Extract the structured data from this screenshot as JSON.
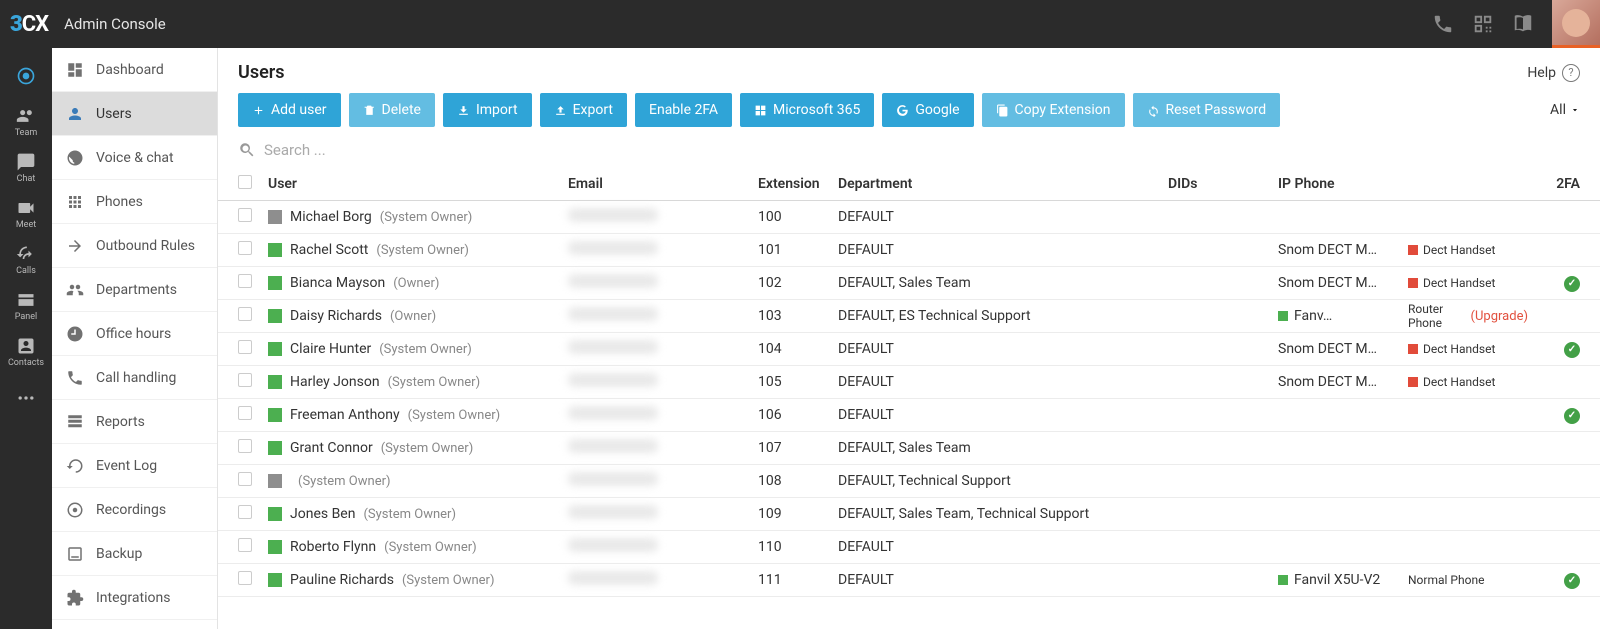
{
  "brand": {
    "name": "3CX",
    "subtitle": "Admin Console"
  },
  "help_label": "Help",
  "iconbar": [
    {
      "name": "chrome",
      "label": ""
    },
    {
      "name": "team",
      "label": "Team"
    },
    {
      "name": "chat",
      "label": "Chat"
    },
    {
      "name": "meet",
      "label": "Meet"
    },
    {
      "name": "calls",
      "label": "Calls"
    },
    {
      "name": "panel",
      "label": "Panel"
    },
    {
      "name": "contacts",
      "label": "Contacts"
    },
    {
      "name": "more",
      "label": ""
    }
  ],
  "sidenav": [
    {
      "name": "dashboard",
      "label": "Dashboard"
    },
    {
      "name": "users",
      "label": "Users",
      "active": true
    },
    {
      "name": "voice-chat",
      "label": "Voice & chat"
    },
    {
      "name": "phones",
      "label": "Phones"
    },
    {
      "name": "outbound-rules",
      "label": "Outbound Rules"
    },
    {
      "name": "departments",
      "label": "Departments"
    },
    {
      "name": "office-hours",
      "label": "Office hours"
    },
    {
      "name": "call-handling",
      "label": "Call handling"
    },
    {
      "name": "reports",
      "label": "Reports"
    },
    {
      "name": "event-log",
      "label": "Event Log"
    },
    {
      "name": "recordings",
      "label": "Recordings"
    },
    {
      "name": "backup",
      "label": "Backup"
    },
    {
      "name": "integrations",
      "label": "Integrations"
    }
  ],
  "page_title": "Users",
  "toolbar": {
    "add_user": "Add user",
    "delete": "Delete",
    "import": "Import",
    "export": "Export",
    "enable_2fa": "Enable 2FA",
    "microsoft_365": "Microsoft 365",
    "google": "Google",
    "copy_extension": "Copy Extension",
    "reset_password": "Reset Password",
    "filter": "All"
  },
  "search_placeholder": "Search ...",
  "columns": {
    "user": "User",
    "email": "Email",
    "extension": "Extension",
    "department": "Department",
    "dids": "DIDs",
    "ip_phone": "IP Phone",
    "twofa": "2FA"
  },
  "rows": [
    {
      "status": "grey",
      "name": "Michael Borg",
      "role": "(System Owner)",
      "ext": "100",
      "dept": "DEFAULT",
      "ip": "",
      "tag": "",
      "tag_status": "",
      "twofa": false
    },
    {
      "status": "green",
      "name": "Rachel Scott",
      "role": "(System Owner)",
      "ext": "101",
      "dept": "DEFAULT",
      "ip": "Snom DECT M…",
      "tag": "Dect Handset",
      "tag_status": "red",
      "twofa": false
    },
    {
      "status": "green",
      "name": "Bianca Mayson",
      "role": "(Owner)",
      "ext": "102",
      "dept": "DEFAULT, Sales Team",
      "ip": "Snom DECT M…",
      "tag": "Dect Handset",
      "tag_status": "red",
      "twofa": true
    },
    {
      "status": "green",
      "name": "Daisy Richards",
      "role": "(Owner)",
      "ext": "103",
      "dept": "DEFAULT, ES Technical Support",
      "ip": "Fanv…",
      "ip_status": "green",
      "tag": "Router Phone",
      "tag_extra": "(Upgrade)",
      "tag_status": "",
      "twofa": false
    },
    {
      "status": "green",
      "name": "Claire Hunter",
      "role": "(System Owner)",
      "ext": "104",
      "dept": "DEFAULT",
      "ip": "Snom DECT M…",
      "tag": "Dect Handset",
      "tag_status": "red",
      "twofa": true
    },
    {
      "status": "green",
      "name": "Harley Jonson",
      "role": "(System Owner)",
      "ext": "105",
      "dept": "DEFAULT",
      "ip": "Snom DECT M…",
      "tag": "Dect Handset",
      "tag_status": "red",
      "twofa": false
    },
    {
      "status": "green",
      "name": "Freeman Anthony",
      "role": "(System Owner)",
      "ext": "106",
      "dept": "DEFAULT",
      "ip": "",
      "tag": "",
      "tag_status": "",
      "twofa": true
    },
    {
      "status": "green",
      "name": "Grant Connor",
      "role": "(System Owner)",
      "ext": "107",
      "dept": "DEFAULT, Sales Team",
      "ip": "",
      "tag": "",
      "tag_status": "",
      "twofa": false
    },
    {
      "status": "grey",
      "name": "",
      "role": "(System Owner)",
      "ext": "108",
      "dept": "DEFAULT, Technical Support",
      "ip": "",
      "tag": "",
      "tag_status": "",
      "twofa": false
    },
    {
      "status": "green",
      "name": "Jones Ben",
      "role": "(System Owner)",
      "ext": "109",
      "dept": "DEFAULT, Sales Team, Technical Support",
      "ip": "",
      "tag": "",
      "tag_status": "",
      "twofa": false
    },
    {
      "status": "green",
      "name": "Roberto Flynn",
      "role": "(System Owner)",
      "ext": "110",
      "dept": "DEFAULT",
      "ip": "",
      "tag": "",
      "tag_status": "",
      "twofa": false
    },
    {
      "status": "green",
      "name": "Pauline Richards",
      "role": "(System Owner)",
      "ext": "111",
      "dept": "DEFAULT",
      "ip": "Fanvil X5U-V2",
      "ip_status": "green",
      "tag": "Normal Phone",
      "tag_status": "",
      "twofa": true
    }
  ]
}
